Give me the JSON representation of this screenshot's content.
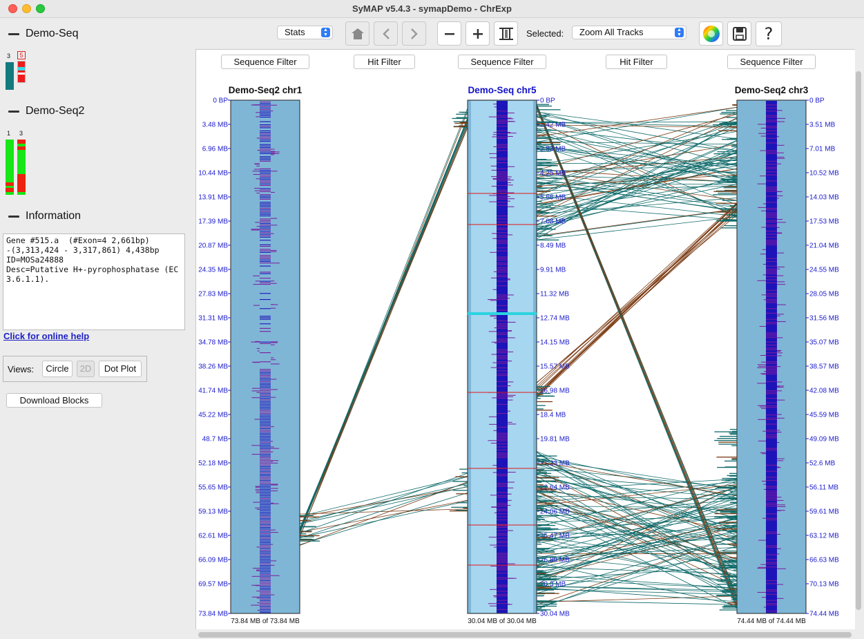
{
  "window": {
    "title": "SyMAP v5.4.3 - symapDemo - ChrExp"
  },
  "left_panel": {
    "sections": [
      {
        "title": "Demo-Seq",
        "chroms": [
          "3",
          "5"
        ]
      },
      {
        "title": "Demo-Seq2",
        "chroms": [
          "1",
          "3"
        ]
      },
      {
        "title": "Information"
      }
    ],
    "info_text": "Gene #515.a  (#Exon=4 2,661bp)\n-(3,313,424 - 3,317,861) 4,438bp\nID=MOSa24888\nDesc=Putative H+-pyrophosphatase (EC 3.6.1.1).",
    "help_link": "Click for online help",
    "views_label": "Views:",
    "views_buttons": [
      "Circle",
      "2D",
      "Dot Plot"
    ],
    "download_label": "Download Blocks"
  },
  "toolbar": {
    "stats_label": "Stats",
    "selected_label": "Selected:",
    "selected_value": "Zoom All Tracks",
    "icons": [
      "home-icon",
      "back-icon",
      "forward-icon",
      "zoom-out-icon",
      "zoom-in-icon",
      "fit-icon",
      "color-wheel-icon",
      "save-icon",
      "help-icon"
    ]
  },
  "filters": [
    "Sequence Filter",
    "Hit Filter",
    "Sequence Filter",
    "Hit Filter",
    "Sequence Filter"
  ],
  "tracks": [
    {
      "title": "Demo-Seq2 chr1",
      "ticks": [
        "0 BP",
        "3.48 MB",
        "6.96 MB",
        "10.44 MB",
        "13.91 MB",
        "17.39 MB",
        "20.87 MB",
        "24.35 MB",
        "27.83 MB",
        "31.31 MB",
        "34.78 MB",
        "38.26 MB",
        "41.74 MB",
        "45.22 MB",
        "48.7 MB",
        "52.18 MB",
        "55.65 MB",
        "59.13 MB",
        "62.61 MB",
        "66.09 MB",
        "69.57 MB",
        "73.84 MB"
      ],
      "footer": "73.84 MB of 73.84 MB"
    },
    {
      "title": "Demo-Seq chr5",
      "ticks": [
        "0 BP",
        "1.42 MB",
        "2.83 MB",
        "4.25 MB",
        "5.66 MB",
        "7.08 MB",
        "8.49 MB",
        "9.91 MB",
        "11.32 MB",
        "12.74 MB",
        "14.15 MB",
        "15.57 MB",
        "16.98 MB",
        "18.4 MB",
        "19.81 MB",
        "21.23 MB",
        "22.64 MB",
        "24.06 MB",
        "25.47 MB",
        "26.89 MB",
        "28.3 MB",
        "30.04 MB"
      ],
      "footer": "30.04 MB of 30.04 MB"
    },
    {
      "title": "Demo-Seq2 chr3",
      "ticks": [
        "0 BP",
        "3.51 MB",
        "7.01 MB",
        "10.52 MB",
        "14.03 MB",
        "17.53 MB",
        "21.04 MB",
        "24.55 MB",
        "28.05 MB",
        "31.56 MB",
        "35.07 MB",
        "38.57 MB",
        "42.08 MB",
        "45.59 MB",
        "49.09 MB",
        "52.6 MB",
        "56.11 MB",
        "59.61 MB",
        "63.12 MB",
        "66.63 MB",
        "70.13 MB",
        "74.44 MB"
      ],
      "footer": "74.44 MB of 74.44 MB"
    }
  ],
  "colors": {
    "track_light": "#7fb6d6",
    "track_center": "#a6d6f0",
    "gene_blue": "#1c14b8",
    "gene_purple": "#7a1a9e",
    "hit_teal": "#0f6a6a",
    "hit_brown": "#7a3a12",
    "tick_blue": "#1a1acc",
    "highlight_cyan": "#2ad4e0"
  }
}
